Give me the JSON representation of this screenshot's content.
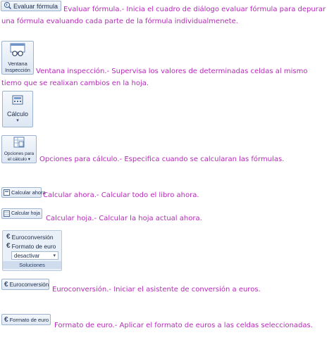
{
  "items": {
    "evaluar": {
      "button_label": "Evaluar fórmula",
      "description": "Evaluar fórmula.- Inicia el cuadro de diálogo evaluar fórmula para depurar una fórmula evaluando cada parte de la fórmula individualmenete."
    },
    "ventana": {
      "button_line1": "Ventana",
      "button_line2": "Inspección",
      "description": "Ventana inspección.- Supervisa los valores de determinadas celdas al mismo tiemo que se realixan cambios en la hoja."
    },
    "calculo": {
      "button_label": "Cálculo"
    },
    "opciones": {
      "button_line1": "Opciones para",
      "button_line2": "el cálculo ▾",
      "description": "Opciones para cálculo.- Especifica cuando se calcularan las fórmulas."
    },
    "calcular_ahora": {
      "button_label": "Calcular ahora",
      "description": "Calcular ahora.- Calcular todo el libro ahora."
    },
    "calcular_hoja": {
      "button_label": "Calcular hoja",
      "description": "Calcular hoja.- Calcular la hoja actual ahora."
    },
    "soluciones_group": {
      "row1": "Euroconversión",
      "row2": "Formato de euro",
      "select_value": "desactivar",
      "title": "Soluciones"
    },
    "euroconversion": {
      "button_label": "Euroconversión",
      "description": "Euroconversión.- Iniciar el asistente de conversión a euros."
    },
    "formato_euro": {
      "button_label": "Formato de euro",
      "description": "Formato de euro.- Aplicar el formato de euros a las celdas seleccionadas."
    }
  },
  "colors": {
    "description_text": "#b52ab8",
    "button_border": "#9db3cf"
  }
}
